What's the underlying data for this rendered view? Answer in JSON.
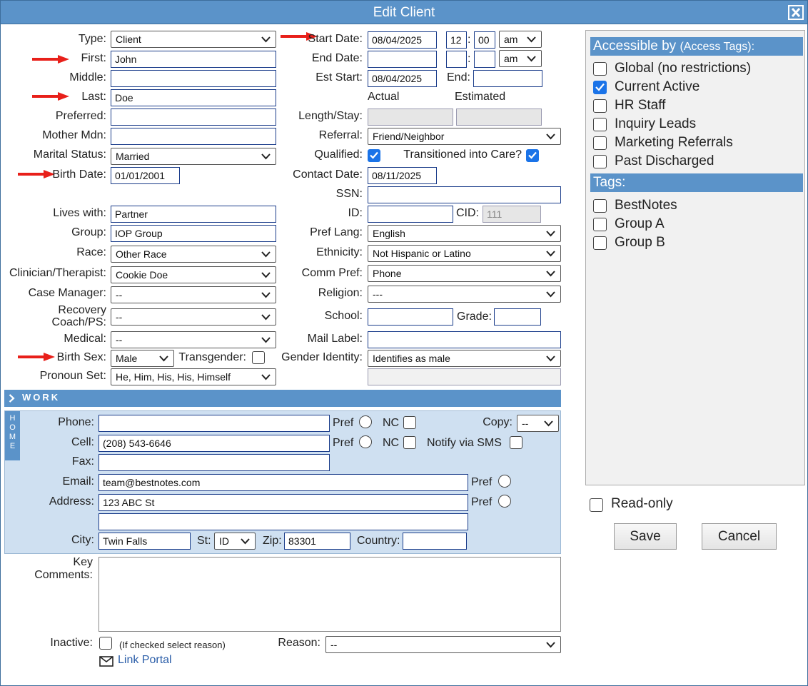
{
  "window": {
    "title": "Edit Client"
  },
  "personal": {
    "type_label": "Type:",
    "type_value": "Client",
    "first_label": "First:",
    "first_value": "John",
    "middle_label": "Middle:",
    "middle_value": "",
    "last_label": "Last:",
    "last_value": "Doe",
    "preferred_label": "Preferred:",
    "preferred_value": "",
    "mother_label": "Mother Mdn:",
    "mother_value": "",
    "marital_label": "Marital Status:",
    "marital_value": "Married",
    "birth_label": "Birth Date:",
    "birth_value": "01/01/2001",
    "lives_label": "Lives with:",
    "lives_value": "Partner",
    "group_label": "Group:",
    "group_value": "IOP Group",
    "race_label": "Race:",
    "race_value": "Other Race",
    "clinician_label": "Clinician/Therapist:",
    "clinician_value": "Cookie Doe",
    "case_label": "Case Manager:",
    "case_value": "--",
    "recovery_label1": "Recovery",
    "recovery_label2": "Coach/PS:",
    "recovery_value": "--",
    "medical_label": "Medical:",
    "medical_value": "--",
    "sex_label": "Birth Sex:",
    "sex_value": "Male",
    "transgender_label": "Transgender:",
    "pronoun_label": "Pronoun Set:",
    "pronoun_value": "He, Him, His, His, Himself"
  },
  "admission": {
    "start_label": "Start Date:",
    "start_value": "08/04/2025",
    "start_hour": "12",
    "start_min": "00",
    "start_ampm": "am",
    "end_label": "End Date:",
    "end_value": "",
    "end_hour": "",
    "end_min": "",
    "end_ampm": "am",
    "est_label": "Est Start:",
    "est_value": "08/04/2025",
    "est_end_label": "End:",
    "est_end_value": "",
    "actual_label": "Actual",
    "estimated_label": "Estimated",
    "length_label": "Length/Stay:",
    "referral_label": "Referral:",
    "referral_value": "Friend/Neighbor",
    "qualified_label": "Qualified:",
    "transitioned_label": "Transitioned into Care?",
    "contact_label": "Contact Date:",
    "contact_value": "08/11/2025",
    "ssn_label": "SSN:",
    "ssn_value": "",
    "id_label": "ID:",
    "id_value": "",
    "cid_label": "CID:",
    "cid_value": "111",
    "lang_label": "Pref Lang:",
    "lang_value": "English",
    "ethnicity_label": "Ethnicity:",
    "ethnicity_value": "Not Hispanic or Latino",
    "comm_label": "Comm Pref:",
    "comm_value": "Phone",
    "religion_label": "Religion:",
    "religion_value": "---",
    "school_label": "School:",
    "school_value": "",
    "grade_label": "Grade:",
    "grade_value": "",
    "mail_label": "Mail Label:",
    "mail_value": "",
    "gender_label": "Gender Identity:",
    "gender_value": "Identifies as male"
  },
  "work": {
    "label": "WORK"
  },
  "home": {
    "tab_letters": [
      "H",
      "O",
      "M",
      "E"
    ],
    "phone_label": "Phone:",
    "phone_value": "",
    "cell_label": "Cell:",
    "cell_value": "(208) 543-6646",
    "fax_label": "Fax:",
    "fax_value": "",
    "email_label": "Email:",
    "email_value": "team@bestnotes.com",
    "address_label": "Address:",
    "address_value": "123 ABC St",
    "address2_value": "",
    "city_label": "City:",
    "city_value": "Twin Falls",
    "st_label": "St:",
    "st_value": "ID",
    "zip_label": "Zip:",
    "zip_value": "83301",
    "country_label": "Country:",
    "country_value": "",
    "pref_label": "Pref",
    "nc_label": "NC",
    "copy_label": "Copy:",
    "copy_value": "--",
    "sms_label": "Notify via SMS"
  },
  "bottom": {
    "key_label1": "Key",
    "key_label2": "Comments:",
    "inactive_label": "Inactive:",
    "inactive_hint": "(If checked select reason)",
    "reason_label": "Reason:",
    "reason_value": "--",
    "portal_link": "Link Portal"
  },
  "access": {
    "heading": "Accessible by",
    "heading_sub": "(Access Tags):",
    "items": [
      {
        "label": "Global (no restrictions)",
        "checked": false
      },
      {
        "label": "Current Active",
        "checked": true
      },
      {
        "label": "HR Staff",
        "checked": false
      },
      {
        "label": "Inquiry Leads",
        "checked": false
      },
      {
        "label": "Marketing Referrals",
        "checked": false
      },
      {
        "label": "Past Discharged",
        "checked": false
      }
    ]
  },
  "tags": {
    "heading": "Tags:",
    "items": [
      {
        "label": "BestNotes",
        "checked": false
      },
      {
        "label": "Group A",
        "checked": false
      },
      {
        "label": "Group B",
        "checked": false
      }
    ]
  },
  "actions": {
    "readonly_label": "Read-only",
    "save_label": "Save",
    "cancel_label": "Cancel"
  },
  "colors": {
    "accent": "#5b93c9",
    "panel": "#cfe0f1",
    "arrow": "#e8201a",
    "check": "#1a73e8"
  }
}
